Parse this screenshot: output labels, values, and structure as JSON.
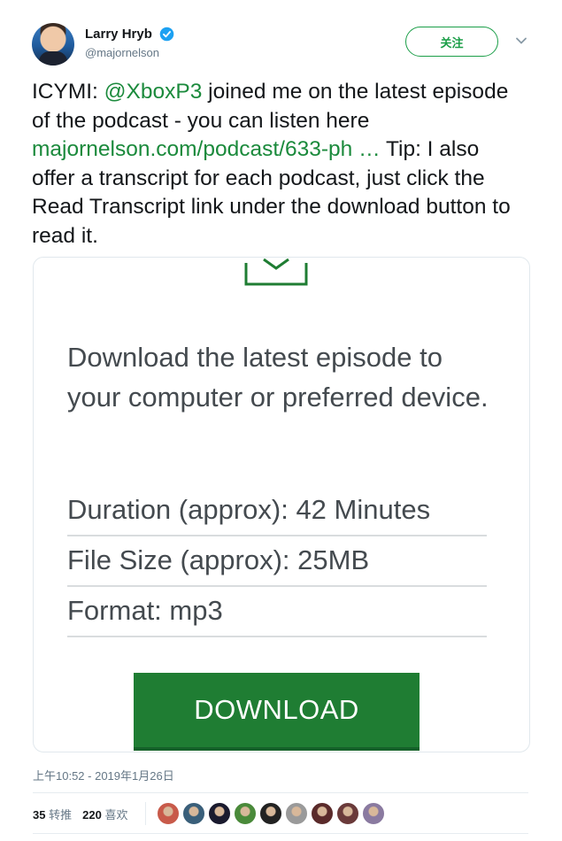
{
  "author": {
    "display_name": "Larry Hryb",
    "handle": "@majornelson",
    "follow_label": "关注"
  },
  "tweet": {
    "before_mention": "ICYMI: ",
    "mention": "@XboxP3",
    "after_mention": " joined me on the latest episode of the podcast - you can listen here ",
    "link": "majornelson.com/podcast/633-ph …",
    "after_link": "  Tip: I also offer a transcript for each podcast, just click the Read Transcript link under the download button to read it."
  },
  "card": {
    "description": "Download the latest episode to your computer or preferred device.",
    "duration": "Duration (approx): 42 Minutes",
    "file_size": "File Size (approx): 25MB",
    "format": "Format: mp3",
    "download_label": "DOWNLOAD",
    "accent_color": "#1f7d33"
  },
  "timestamp": "上午10:52 - 2019年1月26日",
  "stats": {
    "retweets_count": "35",
    "retweets_label": "转推",
    "likes_count": "220",
    "likes_label": "喜欢"
  },
  "likers": [
    {
      "color": "#c85a4a"
    },
    {
      "color": "#3a5f7a"
    },
    {
      "color": "#1a1a2e"
    },
    {
      "color": "#4a8a3a"
    },
    {
      "color": "#222222"
    },
    {
      "color": "#9a9a9a"
    },
    {
      "color": "#5a2a2a"
    },
    {
      "color": "#6a3a3a"
    },
    {
      "color": "#8a7aa0"
    }
  ]
}
